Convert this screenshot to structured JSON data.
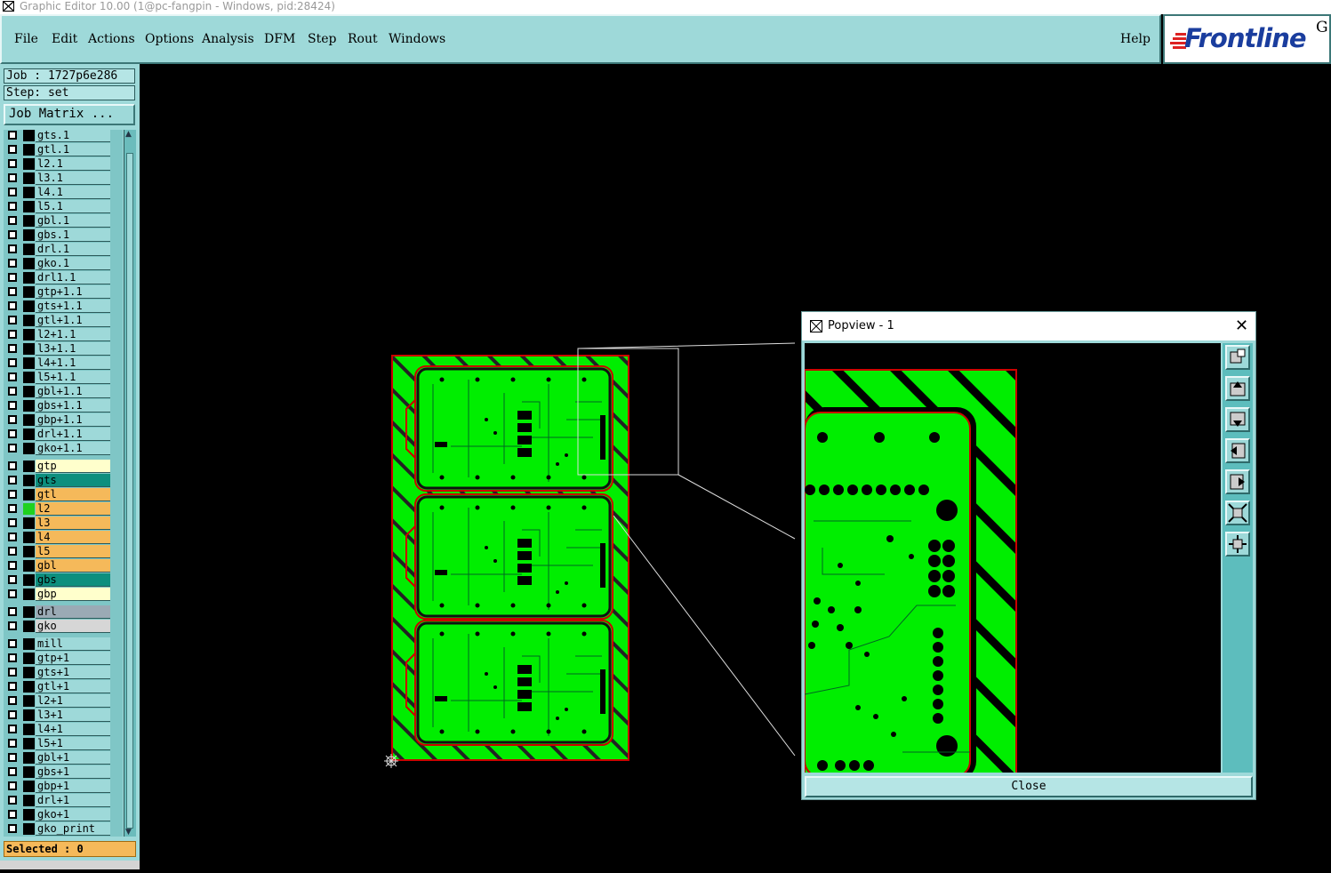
{
  "window": {
    "title": "Graphic Editor 10.00 (1@pc-fangpin - Windows, pid:28424)"
  },
  "menu": {
    "items": [
      "File",
      "Edit",
      "Actions",
      "Options",
      "Analysis",
      "DFM",
      "Step",
      "Rout",
      "Windows"
    ],
    "help": "Help"
  },
  "logo": {
    "text": "Frontline",
    "suffix": "G"
  },
  "info": {
    "job": "Job : 1727p6e286",
    "step": "Step: set",
    "job_matrix": "Job Matrix ..."
  },
  "layers": [
    {
      "name": "gts.1",
      "group": "a"
    },
    {
      "name": "gtl.1",
      "group": "a"
    },
    {
      "name": "l2.1",
      "group": "a"
    },
    {
      "name": "l3.1",
      "group": "a"
    },
    {
      "name": "l4.1",
      "group": "a"
    },
    {
      "name": "l5.1",
      "group": "a"
    },
    {
      "name": "gbl.1",
      "group": "a"
    },
    {
      "name": "gbs.1",
      "group": "a"
    },
    {
      "name": "drl.1",
      "group": "a"
    },
    {
      "name": "gko.1",
      "group": "a"
    },
    {
      "name": "drl1.1",
      "group": "a"
    },
    {
      "name": "gtp+1.1",
      "group": "a"
    },
    {
      "name": "gts+1.1",
      "group": "a"
    },
    {
      "name": "gtl+1.1",
      "group": "a"
    },
    {
      "name": "l2+1.1",
      "group": "a"
    },
    {
      "name": "l3+1.1",
      "group": "a"
    },
    {
      "name": "l4+1.1",
      "group": "a"
    },
    {
      "name": "l5+1.1",
      "group": "a"
    },
    {
      "name": "gbl+1.1",
      "group": "a"
    },
    {
      "name": "gbs+1.1",
      "group": "a"
    },
    {
      "name": "gbp+1.1",
      "group": "a"
    },
    {
      "name": "drl+1.1",
      "group": "a"
    },
    {
      "name": "gko+1.1",
      "group": "a"
    },
    {
      "name": "gtp",
      "group": "b",
      "color": "#ffffcc"
    },
    {
      "name": "gts",
      "group": "b",
      "color": "#0d8f7e"
    },
    {
      "name": "gtl",
      "group": "b",
      "color": "#f5b95a"
    },
    {
      "name": "l2",
      "group": "b",
      "color": "#f5b95a",
      "active": true
    },
    {
      "name": "l3",
      "group": "b",
      "color": "#f5b95a"
    },
    {
      "name": "l4",
      "group": "b",
      "color": "#f5b95a"
    },
    {
      "name": "l5",
      "group": "b",
      "color": "#f5b95a"
    },
    {
      "name": "gbl",
      "group": "b",
      "color": "#f5b95a"
    },
    {
      "name": "gbs",
      "group": "b",
      "color": "#0d8f7e"
    },
    {
      "name": "gbp",
      "group": "b",
      "color": "#ffffcc"
    },
    {
      "name": "drl",
      "group": "c",
      "color": "#9aaab5"
    },
    {
      "name": "gko",
      "group": "c",
      "color": "#d6d6d6"
    },
    {
      "name": "mill",
      "group": "d"
    },
    {
      "name": "gtp+1",
      "group": "d"
    },
    {
      "name": "gts+1",
      "group": "d"
    },
    {
      "name": "gtl+1",
      "group": "d"
    },
    {
      "name": "l2+1",
      "group": "d"
    },
    {
      "name": "l3+1",
      "group": "d"
    },
    {
      "name": "l4+1",
      "group": "d"
    },
    {
      "name": "l5+1",
      "group": "d"
    },
    {
      "name": "gbl+1",
      "group": "d"
    },
    {
      "name": "gbs+1",
      "group": "d"
    },
    {
      "name": "gbp+1",
      "group": "d"
    },
    {
      "name": "drl+1",
      "group": "d"
    },
    {
      "name": "gko+1",
      "group": "d"
    },
    {
      "name": "gko_print",
      "group": "d"
    }
  ],
  "status": {
    "selected": "Selected : 0"
  },
  "popview": {
    "title": "Popview - 1",
    "close_label": "Close",
    "tools": [
      "zoom-fit-icon",
      "pan-up-icon",
      "pan-down-icon",
      "pan-left-icon",
      "pan-right-icon",
      "zoom-out-icon",
      "zoom-in-icon"
    ]
  },
  "colors": {
    "panel": "#9ed9d9",
    "copper": "#00ff00",
    "profile": "#cc0000",
    "highlight": "#f5b95a"
  }
}
